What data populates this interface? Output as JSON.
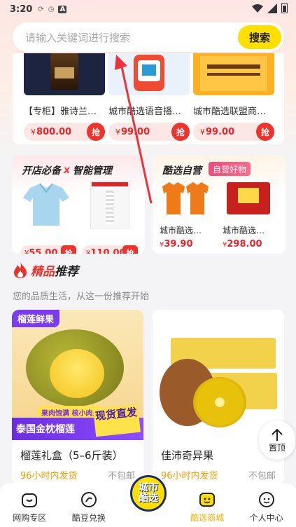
{
  "status_bar": {
    "time": "3:20"
  },
  "search": {
    "placeholder": "请输入关键词进行搜索",
    "button_label": "搜索"
  },
  "top_products": [
    {
      "title": "【专柜】雅诗兰…",
      "yen": "¥",
      "price": "800.00",
      "action": "抢"
    },
    {
      "title": "城市酷选语音播…",
      "yen": "¥",
      "price": "99.00",
      "action": "抢"
    },
    {
      "title": "城市酷选联盟商…",
      "yen": "¥",
      "price": "99.00",
      "action": "抢"
    }
  ],
  "promo_left": {
    "title_a": "开店必备",
    "title_x": "x",
    "title_b": "智能管理",
    "items": [
      {
        "yen": "¥",
        "price": "55.00",
        "action": "抢"
      },
      {
        "yen": "¥",
        "price": "110.00",
        "action": "抢"
      }
    ]
  },
  "promo_right": {
    "title": "酷选自营",
    "badge": "自营好物",
    "items": [
      {
        "name": "城市酷选…",
        "yen": "¥",
        "price": "39.90"
      },
      {
        "name": "城市酷选…",
        "yen": "¥",
        "price": "298.00"
      }
    ]
  },
  "recommend": {
    "title_red": "精品",
    "title_black": "推荐",
    "subtitle": "您的品质生活，从这一份推荐开始",
    "items": [
      {
        "name": "榴莲礼盒（5–6斤装）",
        "ship": "96小时内发货",
        "free": "不包邮",
        "tag": "榴莲鲜果",
        "sub_tag": "果肉饱满 核小肉多",
        "banner": "泰国金枕榴莲",
        "stamp": "现货直发"
      },
      {
        "name": "佳沛奇异果",
        "ship": "96小时内发货",
        "free": "不包邮"
      }
    ]
  },
  "back_to_top": "置顶",
  "bottom_nav": [
    {
      "label": "网购专区"
    },
    {
      "label": "酷豆兑换"
    },
    {
      "label": "酷选商城"
    },
    {
      "label": "个人中心"
    }
  ],
  "center_logo": {
    "line1": "城市",
    "line2": "酷选"
  },
  "colors": {
    "accent_yellow": "#ffdf00",
    "price_red": "#e6262b",
    "active_nav": "#f0b000"
  }
}
